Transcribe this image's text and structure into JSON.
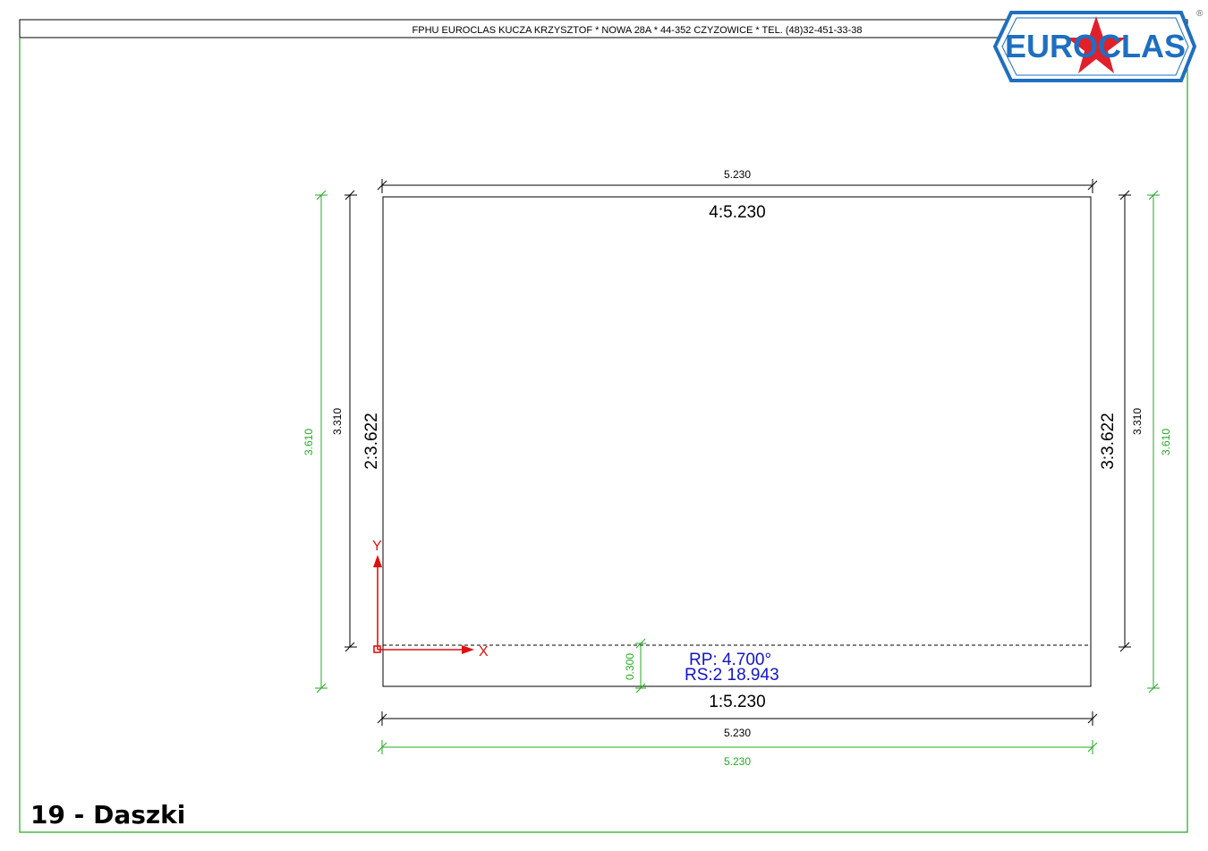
{
  "header": {
    "company_line": "FPHU EUROCLAS KUCZA KRZYSZTOF * NOWA 28A * 44-352 CZYZOWICE * TEL. (48)32-451-33-38"
  },
  "logo": {
    "text": "EUROCLAS",
    "registered": "®"
  },
  "colors": {
    "black": "#000000",
    "green": "#22aa22",
    "blue": "#1414c8",
    "red": "#e01010",
    "logo_blue": "#1e6fc0",
    "logo_red": "#e0202a"
  },
  "dimensions": {
    "top_width": "5.230",
    "bottom_width_black": "5.230",
    "bottom_width_green": "5.230",
    "left_height_black": "3.310",
    "left_height_green": "3.610",
    "right_height_black": "3.310",
    "right_height_green": "3.610",
    "overhang": "0.300"
  },
  "edges": {
    "edge_top": "4:5.230",
    "edge_bottom": "1:5.230",
    "edge_left": "2:3.622",
    "edge_right": "3:3.622"
  },
  "parameters": {
    "rp": "RP:  4.700°",
    "rs": "RS:2  18.943"
  },
  "axes": {
    "x": "X",
    "y": "Y"
  },
  "page_title": "19 - Daszki"
}
